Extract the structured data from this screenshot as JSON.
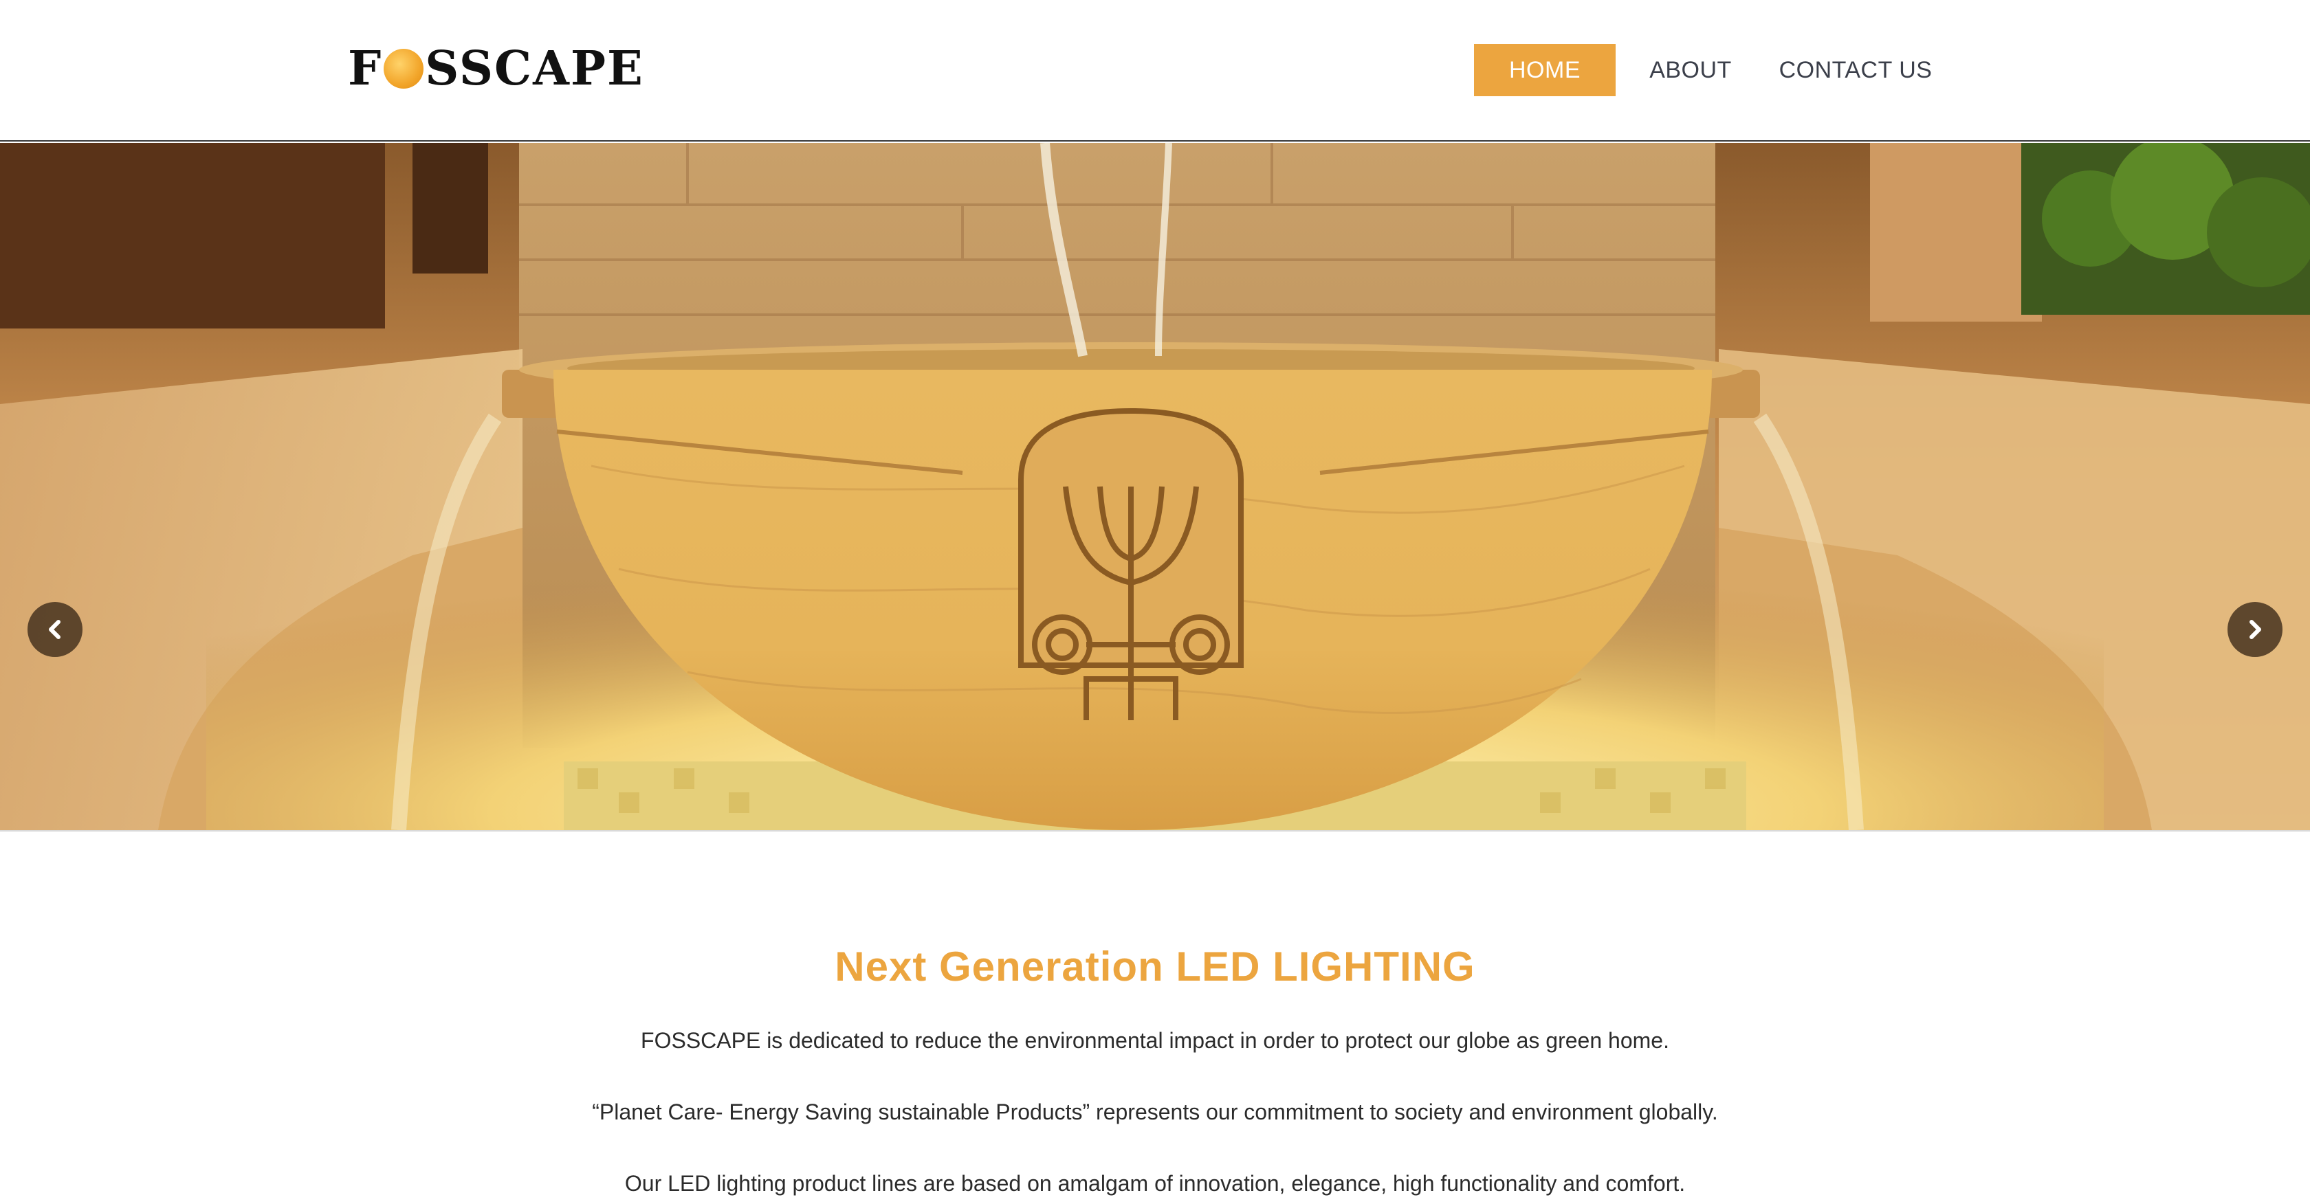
{
  "brand": {
    "logo_text_left": "F",
    "logo_text_right": "SSCAPE",
    "accent_color": "#eca53f"
  },
  "nav": {
    "items": [
      {
        "label": "HOME",
        "active": true
      },
      {
        "label": "ABOUT",
        "active": false
      },
      {
        "label": "CONTACT US",
        "active": false
      }
    ]
  },
  "hero": {
    "prev_icon": "chevron-left-icon",
    "next_icon": "chevron-right-icon",
    "image_subject": "illuminated stone fountain bowl"
  },
  "content": {
    "title": "Next Generation LED LIGHTING",
    "paragraphs": [
      "FOSSCAPE is dedicated to reduce the environmental impact in order to protect our globe as green home.",
      "“Planet Care- Energy Saving sustainable Products” represents our commitment to society and environment globally.",
      "Our LED lighting product lines are based on amalgam of innovation, elegance, high functionality and comfort."
    ]
  }
}
